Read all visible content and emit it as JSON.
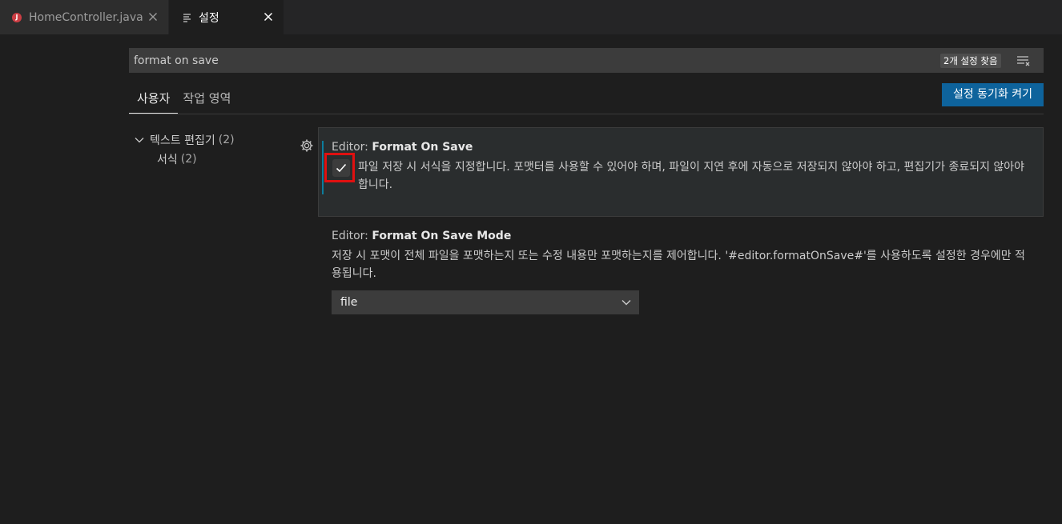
{
  "tabs": [
    {
      "label": "HomeController.java",
      "icon": "java-file-icon",
      "active": false
    },
    {
      "label": "설정",
      "icon": "settings-editor-icon",
      "active": true
    }
  ],
  "search": {
    "value": "format on save",
    "result_count": "2개 설정 찾음"
  },
  "scope_tabs": [
    {
      "label": "사용자",
      "active": true
    },
    {
      "label": "작업 영역",
      "active": false
    }
  ],
  "sync_button": {
    "label": "설정 동기화 켜기"
  },
  "toc": [
    {
      "label": "텍스트 편집기",
      "count": "(2)",
      "expanded": true
    },
    {
      "label": "서식",
      "count": "(2)"
    }
  ],
  "settings": [
    {
      "category": "Editor: ",
      "name": "Format On Save",
      "description": "파일 저장 시 서식을 지정합니다. 포맷터를 사용할 수 있어야 하며, 파일이 지연 후에 자동으로 저장되지 않아야 하고, 편집기가 종료되지 않아야 합니다.",
      "checked": true
    },
    {
      "category": "Editor: ",
      "name": "Format On Save Mode",
      "description": "저장 시 포맷이 전체 파일을 포맷하는지 또는 수정 내용만 포맷하는지를 제어합니다. '#editor.formatOnSave#'를 사용하도록 설정한 경우에만 적용됩니다.",
      "value": "file"
    }
  ],
  "colors": {
    "accent_button": "#0e639c",
    "highlight_annotation": "#e01010",
    "modified_indicator": "#0c7d9d"
  }
}
